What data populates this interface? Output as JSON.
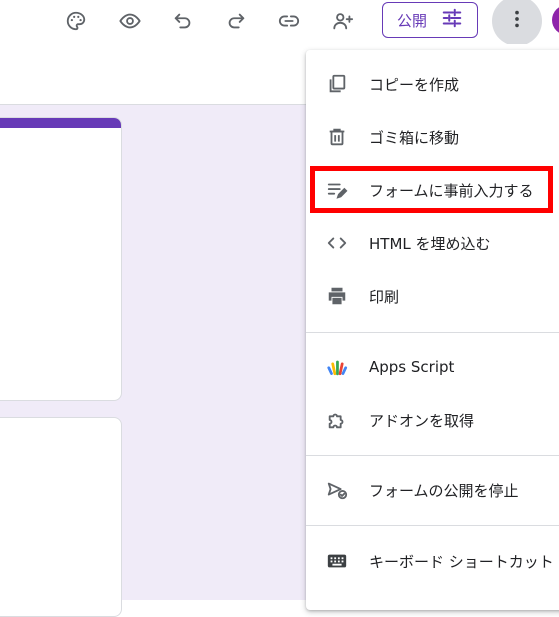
{
  "toolbar": {
    "icons": [
      "palette-icon",
      "eye-icon",
      "undo-icon",
      "redo-icon",
      "link-icon",
      "add-person-icon"
    ],
    "publish_label": "公開",
    "more_icon": "more-vert-icon"
  },
  "colors": {
    "accent": "#673ab7",
    "canvas": "#f0ebf8",
    "highlight": "#ff0000"
  },
  "menu": {
    "items": [
      {
        "label": "コピーを作成",
        "icon": "copy-icon"
      },
      {
        "label": "ゴミ箱に移動",
        "icon": "trash-icon"
      },
      {
        "label": "フォームに事前入力する",
        "icon": "prefill-edit-icon"
      },
      {
        "label": "HTML を埋め込む",
        "icon": "code-icon"
      },
      {
        "label": "印刷",
        "icon": "print-icon"
      },
      {
        "label": "Apps Script",
        "icon": "apps-script-icon"
      },
      {
        "label": "アドオンを取得",
        "icon": "puzzle-icon"
      },
      {
        "label": "フォームの公開を停止",
        "icon": "unpublish-icon"
      },
      {
        "label": "キーボード ショートカット",
        "icon": "keyboard-icon"
      }
    ]
  }
}
